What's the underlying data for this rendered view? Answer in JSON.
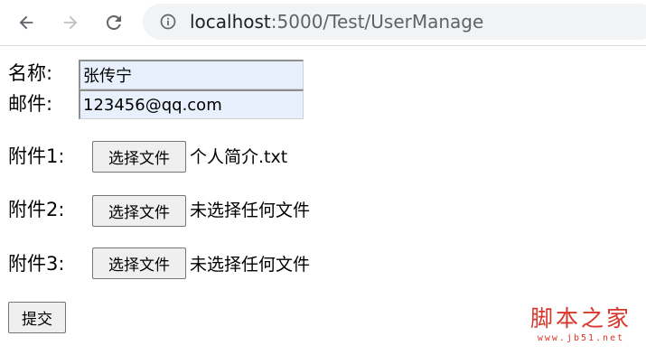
{
  "browser": {
    "url_host": "localhost",
    "url_rest": ":5000/Test/UserManage"
  },
  "form": {
    "name_label": "名称:",
    "name_value": "张传宁",
    "email_label": "邮件:",
    "email_value": "123456@qq.com",
    "attachments": [
      {
        "label": "附件1:",
        "button": "选择文件",
        "status": "个人简介.txt"
      },
      {
        "label": "附件2:",
        "button": "选择文件",
        "status": "未选择任何文件"
      },
      {
        "label": "附件3:",
        "button": "选择文件",
        "status": "未选择任何文件"
      }
    ],
    "submit_label": "提交"
  },
  "watermark": {
    "main": "脚本之家",
    "sub": "www.jb51.net"
  }
}
